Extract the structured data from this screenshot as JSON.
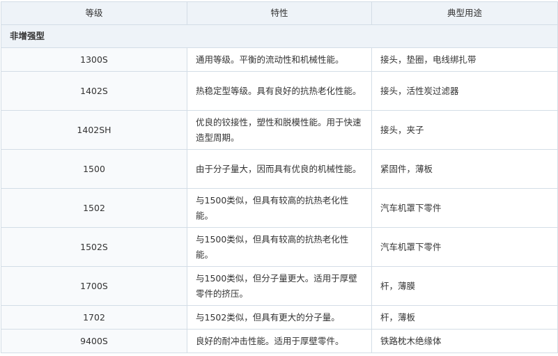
{
  "table": {
    "headers": [
      "等级",
      "特性",
      "典型用途"
    ],
    "section_title": "非增强型",
    "rows": [
      {
        "grade": "1300S",
        "property": "通用等级。平衡的流动性和机械性能。",
        "use": "接头，垫圈，电线绑扎带"
      },
      {
        "grade": "1402S",
        "property": "热稳定型等级。具有良好的抗热老化性能。",
        "use": "接头，活性炭过滤器"
      },
      {
        "grade": "1402SH",
        "property": "优良的铰接性，塑性和脱模性能。用于快速造型周期。",
        "use": "接头，夹子"
      },
      {
        "grade": "1500",
        "property": "由于分子量大，因而具有优良的机械性能。",
        "use": "紧固件，薄板"
      },
      {
        "grade": "1502",
        "property": "与1500类似，但具有较高的抗热老化性能。",
        "use": "汽车机罩下零件"
      },
      {
        "grade": "1502S",
        "property": "与1500类似，但具有较高的抗热老化性能。",
        "use": "汽车机罩下零件"
      },
      {
        "grade": "1700S",
        "property": "与1500类似，但分子量更大。适用于厚壁零件的挤压。",
        "use": "杆，薄膜"
      },
      {
        "grade": "1702",
        "property": "与1502类似，但具有更大的分子量。",
        "use": "杆，薄板"
      },
      {
        "grade": "9400S",
        "property": "良好的耐冲击性能。适用于厚壁零件。",
        "use": "铁路枕木绝缘体"
      }
    ]
  }
}
